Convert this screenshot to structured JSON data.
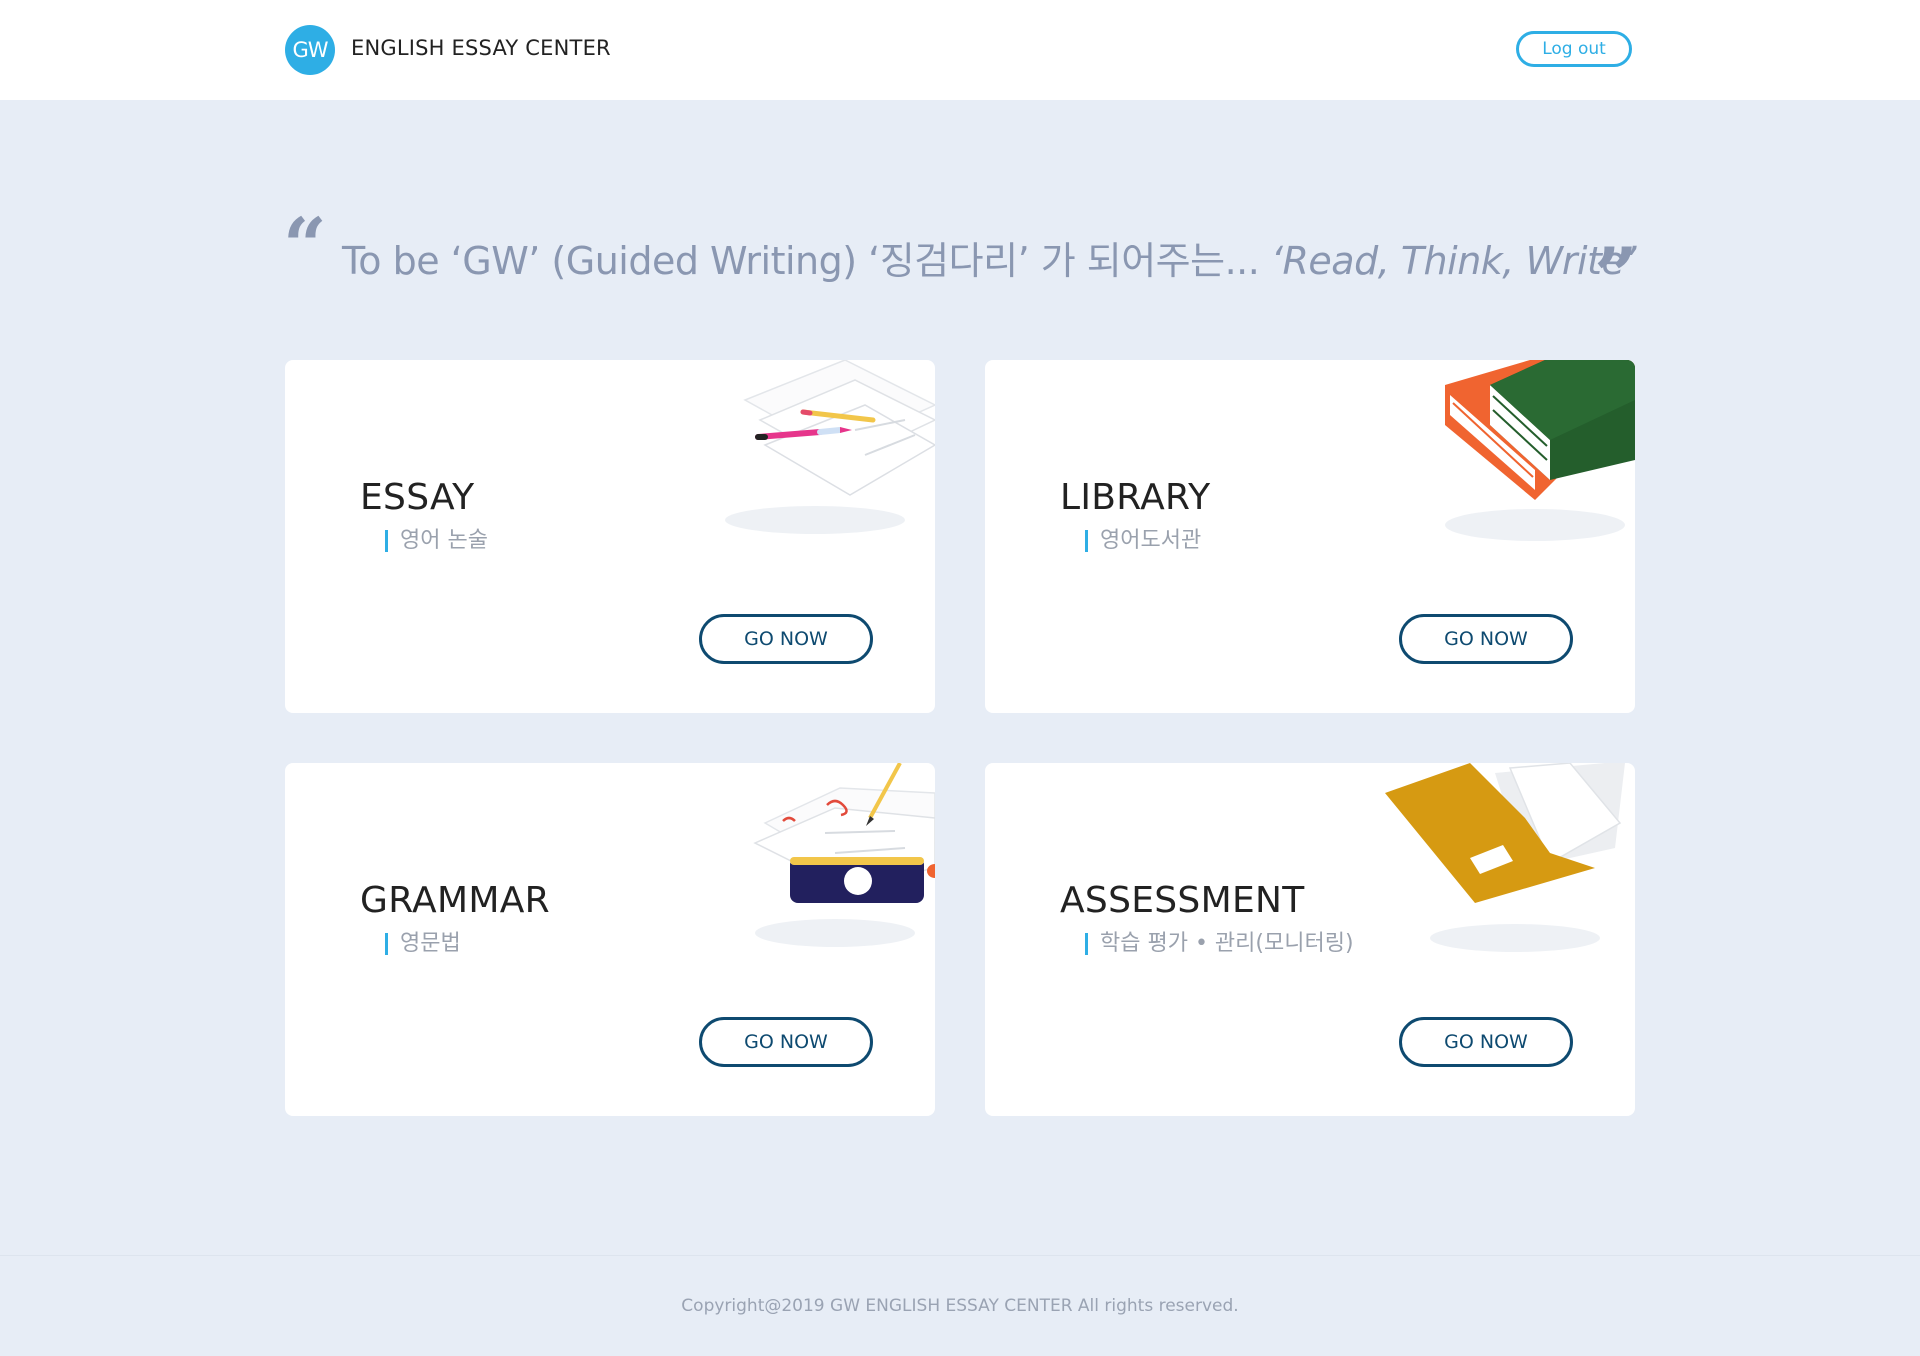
{
  "header": {
    "logo_text": "GW",
    "brand": "ENGLISH ESSAY CENTER",
    "logout_label": "Log out"
  },
  "tagline": {
    "open_quote": "“",
    "text_plain": "To be ‘GW’ (Guided Writing) ‘징검다리’ 가 되어주는... ",
    "text_italic": "‘Read, Think, Write’",
    "close_quote": "”"
  },
  "cards": [
    {
      "title": "ESSAY",
      "subtitle": "영어 논술",
      "button": "GO NOW",
      "icon": "paper-pencil-icon"
    },
    {
      "title": "LIBRARY",
      "subtitle": "영어도서관",
      "button": "GO NOW",
      "icon": "books-icon"
    },
    {
      "title": "GRAMMAR",
      "subtitle": "영문법",
      "button": "GO NOW",
      "icon": "pencil-case-icon"
    },
    {
      "title": "ASSESSMENT",
      "subtitle": "학습 평가 • 관리(모니터링)",
      "button": "GO NOW",
      "icon": "folder-icon"
    }
  ],
  "footer": {
    "copyright": "Copyright@2019 GW ENGLISH ESSAY CENTER All rights reserved."
  },
  "colors": {
    "background": "#e7edf6",
    "accent": "#2eaee5",
    "button_border": "#0e4a70",
    "tagline": "#8a97b1"
  }
}
